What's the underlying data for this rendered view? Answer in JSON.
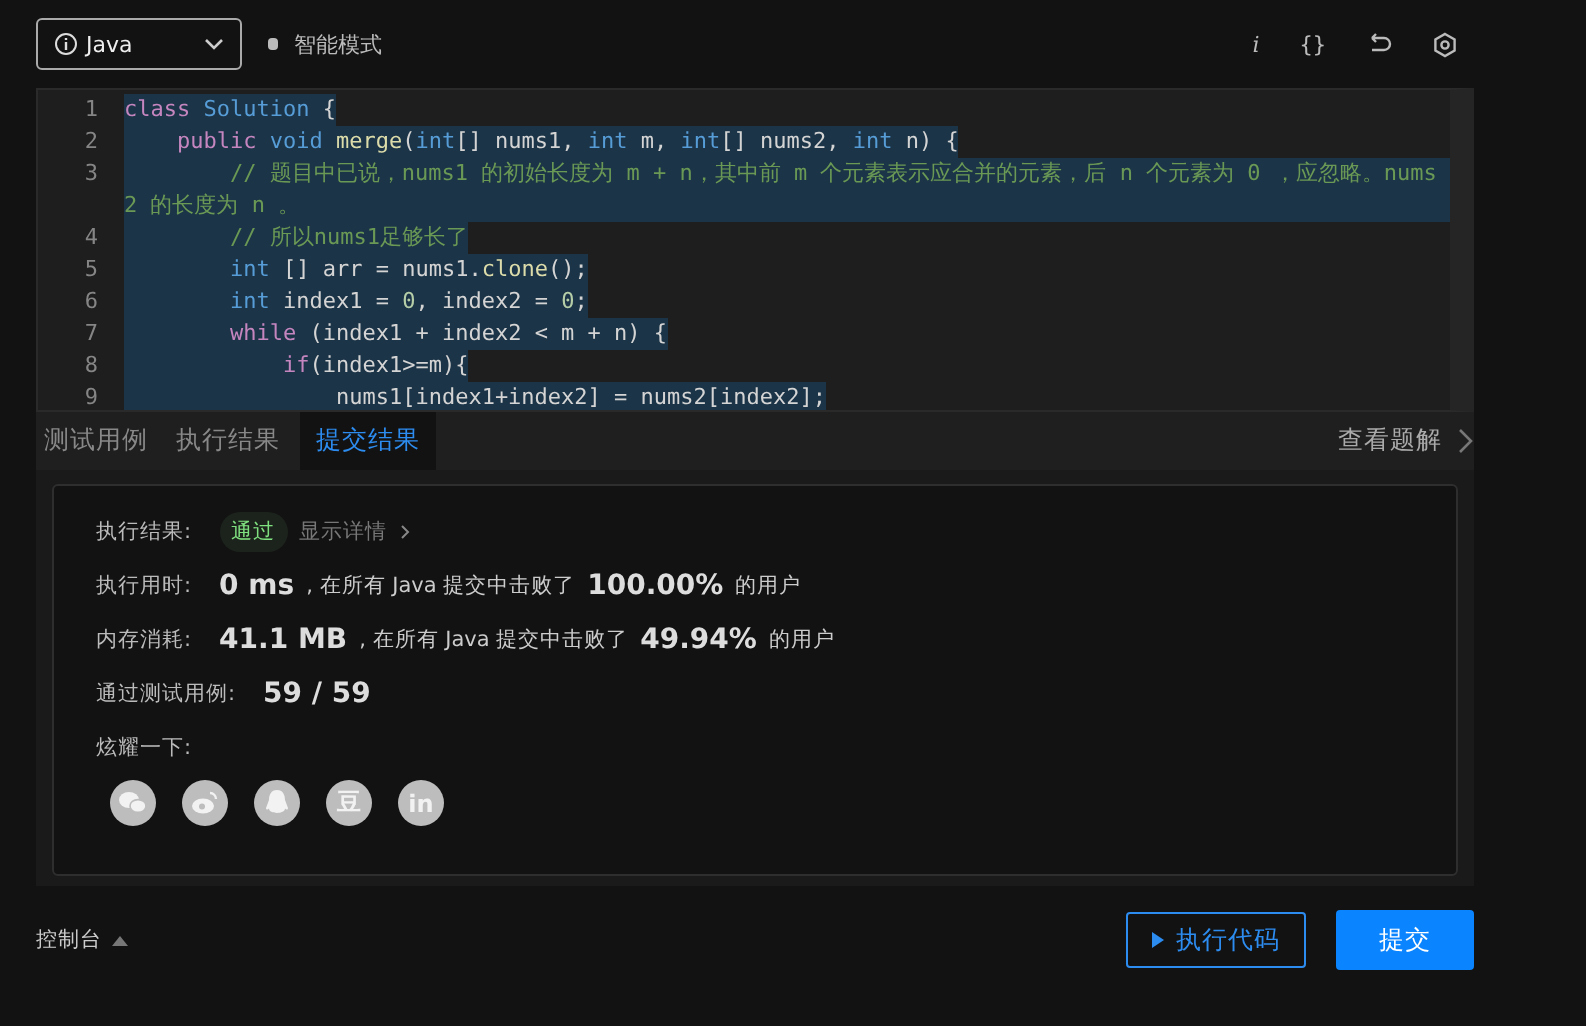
{
  "toolbar": {
    "language": "Java",
    "mode_label": "智能模式",
    "tools": [
      {
        "kind": "text",
        "text": "i"
      },
      {
        "kind": "text",
        "text": "{}"
      },
      {
        "kind": "reset"
      },
      {
        "kind": "settings"
      }
    ]
  },
  "editor": {
    "lines": [
      {
        "number": "1",
        "tokens": [
          {
            "kind": "k",
            "text": "class "
          },
          {
            "kind": "t",
            "text": "Solution"
          },
          {
            "kind": "p",
            "text": " {"
          }
        ]
      },
      {
        "number": "2",
        "tokens": [
          {
            "kind": "k",
            "text": "    public "
          },
          {
            "kind": "t",
            "text": "void "
          },
          {
            "kind": "f",
            "text": "merge"
          },
          {
            "kind": "p",
            "text": "("
          },
          {
            "kind": "t",
            "text": "int"
          },
          {
            "kind": "p",
            "text": "[] nums1, "
          },
          {
            "kind": "t",
            "text": "int"
          },
          {
            "kind": "p",
            "text": " m, "
          },
          {
            "kind": "t",
            "text": "int"
          },
          {
            "kind": "p",
            "text": "[] nums2, "
          },
          {
            "kind": "t",
            "text": "int"
          },
          {
            "kind": "p",
            "text": " n) {"
          }
        ]
      },
      {
        "number": "3",
        "tokens": [
          {
            "kind": "c",
            "text": "        // 题目中已说，nums1 的初始长度为 m + n，其中前 m 个元素表示应合并的元素，后 n 个元素为 0 ，应忽略。nums2 的长度为 n 。"
          }
        ]
      },
      {
        "number": "4",
        "tokens": [
          {
            "kind": "c",
            "text": "        // 所以nums1足够长了"
          }
        ]
      },
      {
        "number": "5",
        "tokens": [
          {
            "kind": "t",
            "text": "        int"
          },
          {
            "kind": "p",
            "text": " [] arr = nums1."
          },
          {
            "kind": "f",
            "text": "clone"
          },
          {
            "kind": "p",
            "text": "();"
          }
        ]
      },
      {
        "number": "6",
        "tokens": [
          {
            "kind": "t",
            "text": "        int"
          },
          {
            "kind": "p",
            "text": " index1 = "
          },
          {
            "kind": "n",
            "text": "0"
          },
          {
            "kind": "p",
            "text": ", index2 = "
          },
          {
            "kind": "n",
            "text": "0"
          },
          {
            "kind": "p",
            "text": ";"
          }
        ]
      },
      {
        "number": "7",
        "tokens": [
          {
            "kind": "k",
            "text": "        while"
          },
          {
            "kind": "p",
            "text": " (index1 + index2 < m + n) {"
          }
        ]
      },
      {
        "number": "8",
        "tokens": [
          {
            "kind": "k",
            "text": "            if"
          },
          {
            "kind": "p",
            "text": "(index1>=m){"
          }
        ]
      },
      {
        "number": "9",
        "tokens": [
          {
            "kind": "p",
            "text": "                nums1[index1+index2] = nums2[index2];"
          }
        ]
      }
    ]
  },
  "tabs": [
    {
      "label": "测试用例",
      "selected": false
    },
    {
      "label": "执行结果",
      "selected": false
    },
    {
      "label": "提交结果",
      "selected": true
    }
  ],
  "solution_link": "查看题解",
  "result": {
    "status_label": "执行结果:",
    "status": "通过",
    "details_link": "显示详情",
    "stats": [
      {
        "label": "执行用时:",
        "parts": [
          {
            "kind": "big",
            "text": "0 ms"
          },
          {
            "kind": "small",
            "text": ", 在所有 Java 提交中击败了"
          },
          {
            "kind": "big",
            "text": "100.00%"
          },
          {
            "kind": "small",
            "text": "的用户"
          }
        ]
      },
      {
        "label": "内存消耗:",
        "parts": [
          {
            "kind": "big",
            "text": "41.1 MB"
          },
          {
            "kind": "small",
            "text": ", 在所有 Java 提交中击败了"
          },
          {
            "kind": "big",
            "text": "49.94%"
          },
          {
            "kind": "small",
            "text": "的用户"
          }
        ]
      },
      {
        "label": "通过测试用例:",
        "parts": [
          {
            "kind": "big",
            "text": "59 / 59"
          }
        ]
      }
    ],
    "share_label": "炫耀一下:",
    "share": [
      {
        "kind": "wechat"
      },
      {
        "kind": "weibo"
      },
      {
        "kind": "qq"
      },
      {
        "kind": "douban",
        "text": "豆"
      },
      {
        "kind": "linkedin",
        "text": "in"
      }
    ]
  },
  "footer": {
    "console": "控制台",
    "run_button": "执行代码",
    "submit_button": "提交"
  }
}
